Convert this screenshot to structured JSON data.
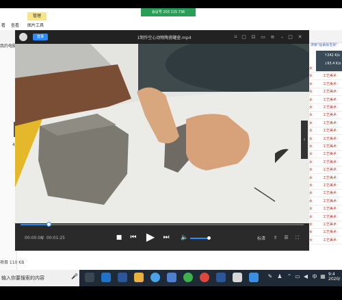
{
  "remote_bar": {
    "text": "会议号 203 115 736"
  },
  "explorer": {
    "manage_tab": "管理",
    "ribbon_tabs": [
      "看",
      "查看",
      "图片工具"
    ],
    "path_fragment": "我的电脑",
    "search_fragment": "搜索\"临摹版雪景\"",
    "status": "项目  110 KB",
    "left_number": "4"
  },
  "player": {
    "login_label": "登录",
    "title": "1制作空心动物陶瓷罐壶.mp4",
    "time_current": "00:00:08",
    "time_separator": "/",
    "time_total": "00:01:25",
    "hd_label": "标清",
    "progress": 0.1,
    "volume": 0.85,
    "side_arrow": "‹"
  },
  "mini_badge": {
    "line1": "↑242 K/s",
    "line2": "↓93.4 K/s"
  },
  "right_list": {
    "rows": [
      {
        "a": "女",
        "b": "",
        "c": "工艺美术"
      },
      {
        "a": "女",
        "b": "",
        "c": "工艺美术"
      },
      {
        "a": "女",
        "b": "",
        "c": "工艺美术"
      },
      {
        "a": "女",
        "b": "",
        "c": "工艺美术"
      },
      {
        "a": "女",
        "b": "",
        "c": "工艺美术"
      },
      {
        "a": "女",
        "b": "",
        "c": "工艺美术"
      },
      {
        "a": "女",
        "b": "",
        "c": "工艺美术"
      },
      {
        "a": "女",
        "b": "",
        "c": "工艺美术"
      },
      {
        "a": "女",
        "b": "",
        "c": "工艺美术"
      },
      {
        "a": "女",
        "b": "",
        "c": "工艺美术"
      },
      {
        "a": "女",
        "b": "",
        "c": "工艺美术"
      },
      {
        "a": "女",
        "b": "",
        "c": "工艺美术"
      },
      {
        "a": "女",
        "b": "",
        "c": "工艺美术"
      },
      {
        "a": "女",
        "b": "",
        "c": "工艺美术"
      },
      {
        "a": "女",
        "b": "",
        "c": "工艺美术"
      },
      {
        "a": "女",
        "b": "",
        "c": "工艺美术"
      },
      {
        "a": "女",
        "b": "",
        "c": "工艺美术"
      },
      {
        "a": "女",
        "b": "",
        "c": "工艺美术"
      },
      {
        "a": "女",
        "b": "",
        "c": "工艺美术"
      },
      {
        "a": "女",
        "b": "",
        "c": "工艺美术"
      },
      {
        "a": "女",
        "b": "",
        "c": "工艺美术"
      },
      {
        "a": "女",
        "b": "",
        "c": "工艺美术"
      },
      {
        "a": "女",
        "b": "",
        "c": "工艺美术"
      }
    ]
  },
  "taskbar": {
    "search_placeholder": "输入你要搜索的内容",
    "clock_time": "9:4",
    "clock_date": "2020/",
    "ime": "中",
    "icons": [
      "task-view-icon",
      "edge-icon",
      "word-icon",
      "file-explorer-icon",
      "sogou-icon",
      "store-icon",
      "wechat-icon",
      "chrome-icon",
      "word2-icon",
      "qq-browser-icon",
      "media-icon"
    ]
  },
  "colors": {
    "accent": "#2b8cff",
    "player_bg": "#1b1b1b",
    "remote_green": "#2a9d57",
    "list_red": "#c0392b"
  }
}
